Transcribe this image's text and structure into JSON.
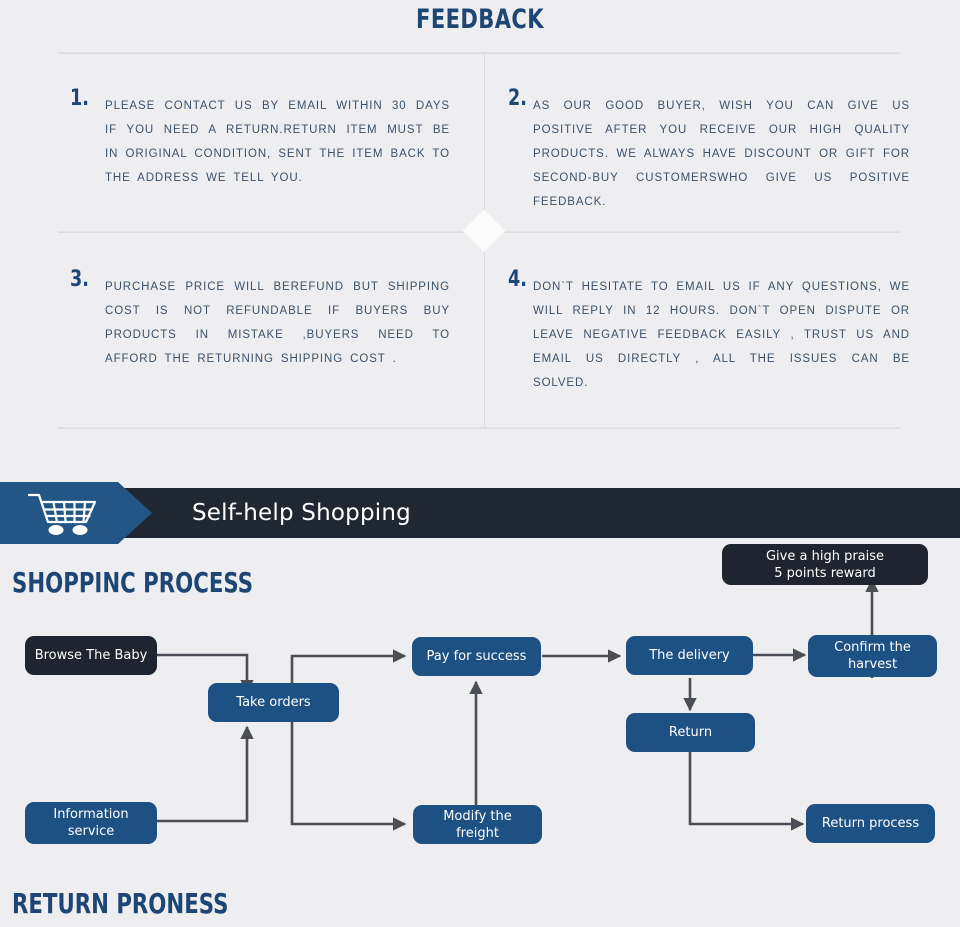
{
  "feedback": {
    "title": "FEEDBACK",
    "items": [
      {
        "number": "1.",
        "text": "PLEASE CONTACT US BY EMAIL WITHIN 30 DAYS IF YOU NEED A RETURN.RETURN ITEM MUST BE IN ORIGINAL CONDITION, SENT THE ITEM BACK TO THE ADDRESS WE TELL YOU."
      },
      {
        "number": "2.",
        "text": "AS OUR GOOD BUYER, WISH YOU CAN GIVE US POSITIVE AFTER YOU RECEIVE OUR HIGH QUALITY PRODUCTS. WE ALWAYS HAVE DISCOUNT OR GIFT FOR SECOND-BUY CUSTOMERSWHO GIVE US POSITIVE FEEDBACK."
      },
      {
        "number": "3.",
        "text": "PURCHASE PRICE WILL BEREFUND BUT SHIPPING COST IS NOT REFUNDABLE IF BUYERS BUY PRODUCTS IN MISTAKE ,BUYERS NEED TO AFFORD THE RETURNING SHIPPING COST ."
      },
      {
        "number": "4.",
        "text": "DON`T HESITATE TO EMAIL US IF ANY QUESTIONS, WE WILL REPLY IN 12 HOURS. DON`T OPEN DISPUTE OR LEAVE NEGATIVE FEEDBACK EASILY , TRUST US AND EMAIL US DIRECTLY , ALL THE ISSUES CAN BE SOLVED."
      }
    ]
  },
  "banner": {
    "title": "Self-help Shopping",
    "icon": "shopping-cart-icon",
    "arrow_color": "#235685",
    "bar_color": "#1f2733"
  },
  "flowchart": {
    "shopping_heading": "SHOPPINC PROCESS",
    "return_heading": "RETURN  PRONESS",
    "colors": {
      "blue_node": "#1d5183",
      "dark_node": "#1e2430",
      "connector": "#4b4f55",
      "background": "#eeeef0"
    },
    "nodes": [
      {
        "id": "browse-the-baby",
        "label": "Browse The Baby",
        "style": "dark"
      },
      {
        "id": "take-orders",
        "label": "Take orders",
        "style": "blue"
      },
      {
        "id": "pay-for-success",
        "label": "Pay for success",
        "style": "blue"
      },
      {
        "id": "the-delivery",
        "label": "The delivery",
        "style": "blue"
      },
      {
        "id": "confirm-harvest",
        "label": "Confirm the harvest",
        "style": "blue"
      },
      {
        "id": "give-high-praise",
        "label": "Give a high praise\n5 points reward",
        "style": "dark"
      },
      {
        "id": "return",
        "label": "Return",
        "style": "blue"
      },
      {
        "id": "information-service",
        "label": "Information service",
        "style": "blue"
      },
      {
        "id": "modify-the-freight",
        "label": "Modify the freight",
        "style": "blue"
      },
      {
        "id": "return-process",
        "label": "Return process",
        "style": "blue"
      }
    ],
    "praise_line1": "Give a high praise",
    "praise_line2": "5 points reward",
    "confirm_line1": "Confirm the",
    "confirm_line2": "harvest",
    "info_line1": "Information",
    "info_line2": "service"
  }
}
